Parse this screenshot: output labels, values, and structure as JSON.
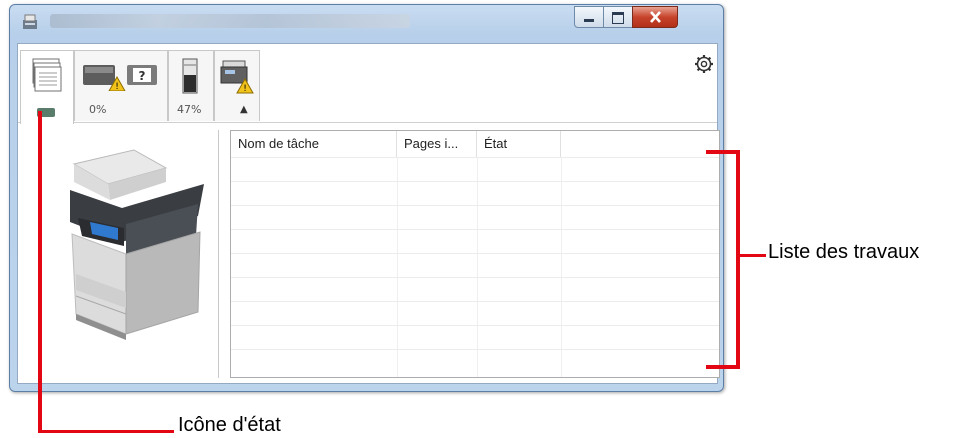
{
  "window": {
    "title": "",
    "controls": {
      "minimize": "minimize-button",
      "maximize": "maximize-button",
      "close": "close-button"
    }
  },
  "tabs": [
    {
      "name": "jobs",
      "icon": "document-stack-icon",
      "label": ""
    },
    {
      "name": "toner",
      "icon": "toner-warning-icon",
      "label": "0%"
    },
    {
      "name": "paper",
      "icon": "paper-level-icon",
      "label": "47%"
    },
    {
      "name": "device",
      "icon": "device-warning-icon",
      "label": ""
    }
  ],
  "collapse_glyph": "▲",
  "table": {
    "columns": [
      "Nom de tâche",
      "Pages i...",
      "État",
      ""
    ],
    "rows": [
      [],
      [],
      [],
      [],
      [],
      [],
      [],
      [],
      []
    ]
  },
  "callouts": {
    "job_list": "Liste des travaux",
    "status_icon": "Icône d'état"
  },
  "colors": {
    "callout": "#e30613",
    "status_icon": "#5a7c6b"
  }
}
